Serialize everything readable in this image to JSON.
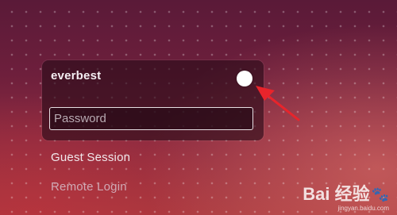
{
  "login": {
    "username": "everbest",
    "password_placeholder": "Password",
    "password_value": ""
  },
  "menu": {
    "guest_session": "Guest Session",
    "remote_login": "Remote Login"
  },
  "watermark": {
    "logo": "Bai 经验",
    "url": "jingyan.baidu.com",
    "paw_icon": "paw-icon"
  },
  "annotation": {
    "arrow_color": "#e8242b"
  },
  "colors": {
    "background_top": "#5a1a38",
    "background_bottom": "#a8393f",
    "card": "#280c18",
    "text": "#f4eef2"
  }
}
